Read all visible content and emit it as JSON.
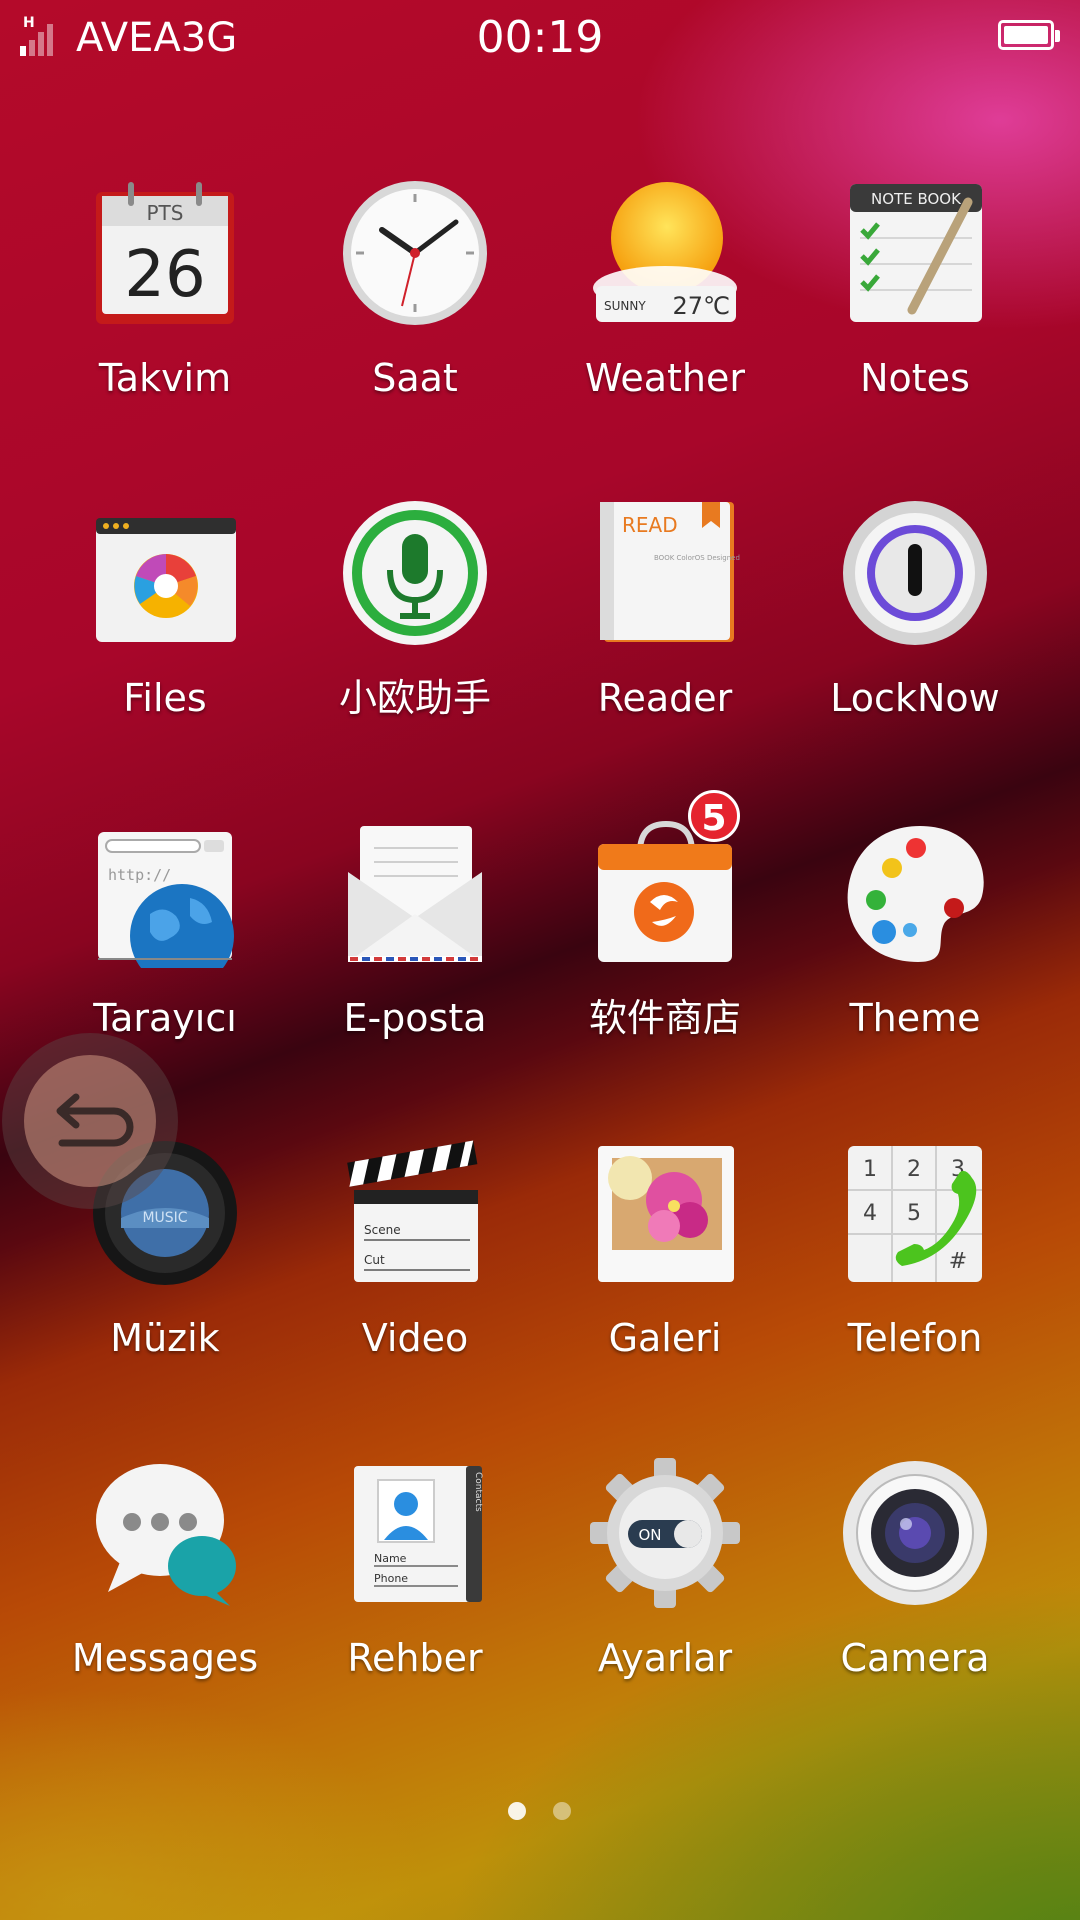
{
  "status_bar": {
    "network_type": "H",
    "carrier": "AVEA3G",
    "time": "00:19",
    "battery_level": 1.0
  },
  "calendar_icon": {
    "day_abbr": "PTS",
    "day_number": "26"
  },
  "weather_icon": {
    "condition": "SUNNY",
    "temperature": "27℃"
  },
  "notes_icon": {
    "header": "NOTE BOOK"
  },
  "reader_icon": {
    "title": "READ",
    "subtitle": "BOOK ColorOS Designed"
  },
  "browser_icon": {
    "url_text": "http://"
  },
  "music_icon": {
    "text": "MUSIC"
  },
  "video_icon": {
    "scene_label": "Scene",
    "cut_label": "Cut"
  },
  "phone_icon": {
    "keys": [
      "1",
      "2",
      "3",
      "4",
      "5",
      "#"
    ]
  },
  "contacts_icon": {
    "tab": "Contacts",
    "name_label": "Name",
    "phone_label": "Phone"
  },
  "settings_icon": {
    "toggle": "ON"
  },
  "store_badge": {
    "count": "5"
  },
  "apps": {
    "takvim": "Takvim",
    "saat": "Saat",
    "weather": "Weather",
    "notes": "Notes",
    "files": "Files",
    "assistant": "小欧助手",
    "reader": "Reader",
    "locknow": "LockNow",
    "tarayici": "Tarayıcı",
    "eposta": "E-posta",
    "store": "软件商店",
    "theme": "Theme",
    "muzik": "Müzik",
    "video": "Video",
    "galeri": "Galeri",
    "telefon": "Telefon",
    "messages": "Messages",
    "rehber": "Rehber",
    "ayarlar": "Ayarlar",
    "camera": "Camera"
  },
  "page_indicator": {
    "current": 1,
    "total": 2
  },
  "icons": [
    "calendar-icon",
    "clock-icon",
    "weather-icon",
    "notes-icon",
    "files-icon",
    "microphone-icon",
    "reader-icon",
    "lock-icon",
    "browser-icon",
    "email-icon",
    "store-bag-icon",
    "palette-icon",
    "music-icon",
    "clapperboard-icon",
    "gallery-icon",
    "phone-icon",
    "messages-icon",
    "contacts-icon",
    "settings-gear-icon",
    "camera-icon",
    "back-arrow-icon"
  ]
}
